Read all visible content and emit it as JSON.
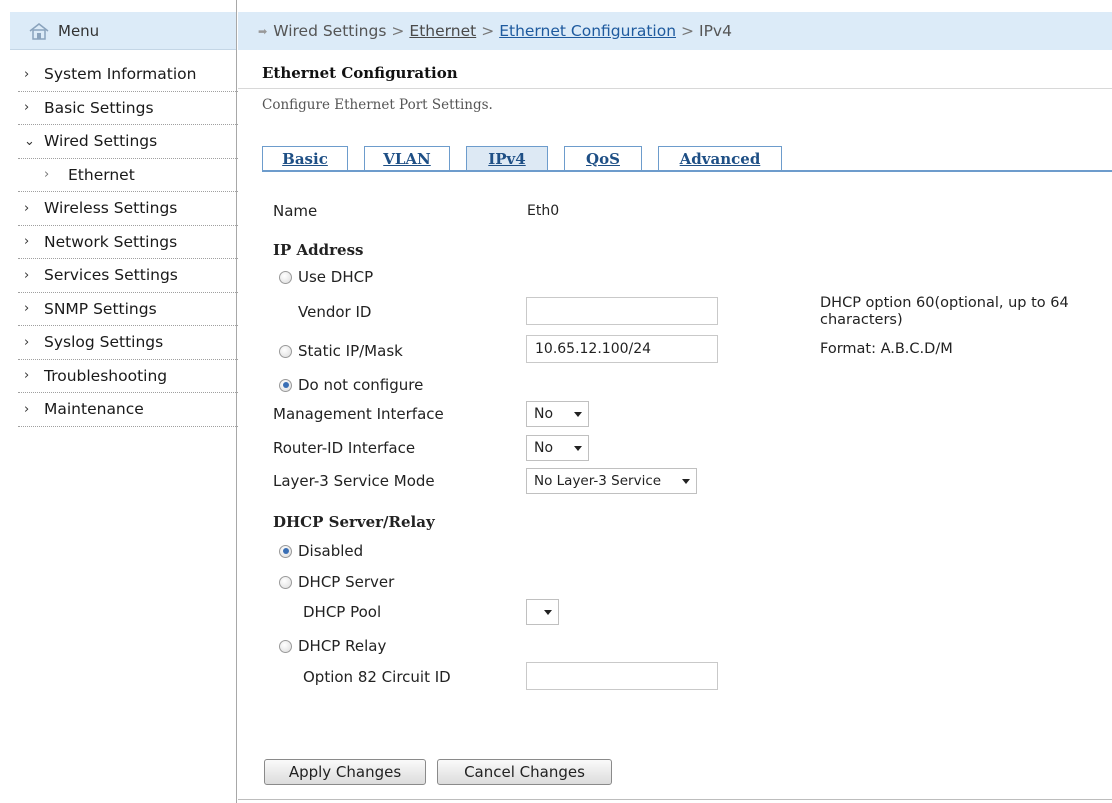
{
  "sidebar": {
    "header": "Menu",
    "items": [
      {
        "label": "System Information",
        "chev": "›"
      },
      {
        "label": "Basic Settings",
        "chev": "›"
      },
      {
        "label": "Wired Settings",
        "chev": "⌄"
      },
      {
        "label": "Ethernet",
        "chev": "›"
      },
      {
        "label": "Wireless Settings",
        "chev": "›"
      },
      {
        "label": "Network Settings",
        "chev": "›"
      },
      {
        "label": "Services Settings",
        "chev": "›"
      },
      {
        "label": "SNMP Settings",
        "chev": "›"
      },
      {
        "label": "Syslog Settings",
        "chev": "›"
      },
      {
        "label": "Troubleshooting",
        "chev": "›"
      },
      {
        "label": "Maintenance",
        "chev": "›"
      }
    ]
  },
  "breadcrumb": {
    "root": "Wired Settings",
    "ethernet": "Ethernet",
    "config": "Ethernet Configuration",
    "current": "IPv4",
    "sep": ">"
  },
  "page": {
    "title": "Ethernet Configuration",
    "description": "Configure Ethernet Port Settings."
  },
  "tabs": [
    "Basic",
    "VLAN",
    "IPv4",
    "QoS",
    "Advanced"
  ],
  "form": {
    "name_label": "Name",
    "name_value": "Eth0",
    "ip_address_heading": "IP Address",
    "use_dhcp": "Use DHCP",
    "vendor_id_label": "Vendor ID",
    "vendor_id_value": "",
    "vendor_id_note": "DHCP option 60(optional, up to 64 characters)",
    "static_ip_label": "Static IP/Mask",
    "static_ip_value": "10.65.12.100/24",
    "static_ip_note": "Format: A.B.C.D/M",
    "do_not_configure": "Do not configure",
    "mgmt_interface_label": "Management Interface",
    "mgmt_interface_value": "No",
    "router_id_label": "Router-ID Interface",
    "router_id_value": "No",
    "l3_mode_label": "Layer-3 Service Mode",
    "l3_mode_value": "No Layer-3 Service",
    "dhcp_heading": "DHCP Server/Relay",
    "disabled": "Disabled",
    "dhcp_server": "DHCP Server",
    "dhcp_pool_label": "DHCP Pool",
    "dhcp_pool_value": "",
    "dhcp_relay": "DHCP Relay",
    "option82_label": "Option 82 Circuit ID",
    "option82_value": ""
  },
  "buttons": {
    "apply": "Apply Changes",
    "cancel": "Cancel Changes"
  },
  "colors": {
    "header_bg": "#dcebf8",
    "tab_border": "#6d9ccc",
    "link_active": "#1e5a9e",
    "radio_selected": "#3a6fb5"
  }
}
